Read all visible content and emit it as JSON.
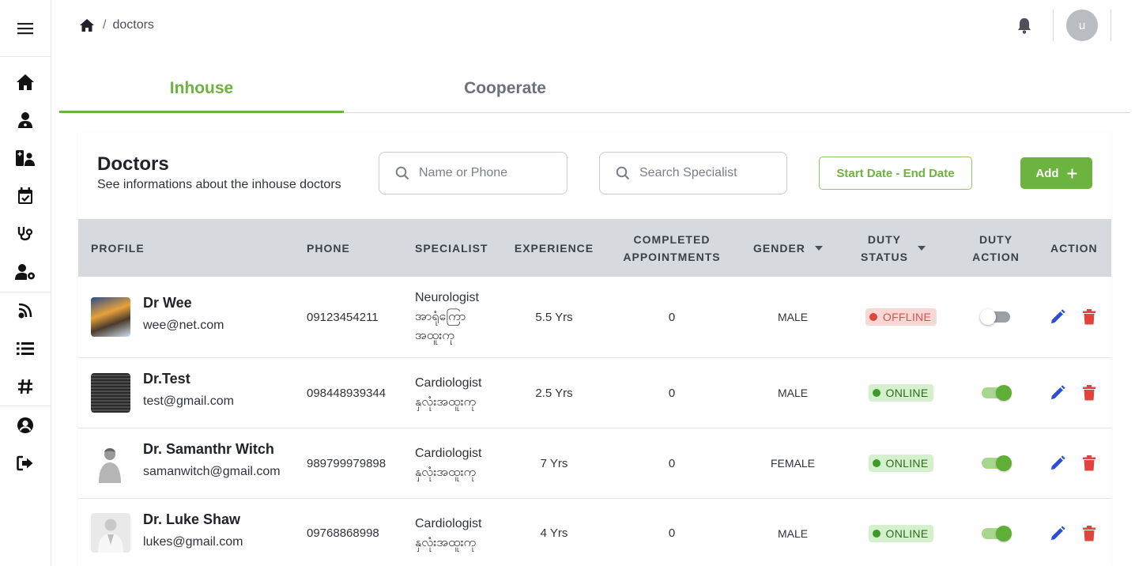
{
  "header": {
    "breadcrumb_separator": "/",
    "breadcrumb_current": "doctors",
    "avatar_initial": "u"
  },
  "tabs": [
    {
      "label": "Inhouse",
      "active": true
    },
    {
      "label": "Cooperate",
      "active": false
    }
  ],
  "card": {
    "title": "Doctors",
    "subtitle": "See informations about the inhouse doctors",
    "search_name_placeholder": "Name or Phone",
    "search_specialist_placeholder": "Search Specialist",
    "date_range_label": "Start Date - End Date",
    "add_label": "Add"
  },
  "table": {
    "columns": {
      "profile": "PROFILE",
      "phone": "PHONE",
      "specialist": "SPECIALIST",
      "experience": "EXPERIENCE",
      "completed_1": "COMPLETED",
      "completed_2": "APPOINTMENTS",
      "gender": "GENDER",
      "duty_status_1": "DUTY",
      "duty_status_2": "STATUS",
      "duty_action_1": "DUTY",
      "duty_action_2": "ACTION",
      "action": "ACTION"
    },
    "rows": [
      {
        "name": "Dr Wee",
        "email": "wee@net.com",
        "phone": "09123454211",
        "specialist_lines": [
          "Neurologist",
          "အာရုံကြော",
          "အထူးကု"
        ],
        "experience": "5.5 Yrs",
        "completed": "0",
        "gender": "MALE",
        "status": "OFFLINE",
        "duty_on": false
      },
      {
        "name": "Dr.Test",
        "email": "test@gmail.com",
        "phone": "098448939344",
        "specialist_lines": [
          "Cardiologist",
          "နှလုံးအထူးကု"
        ],
        "experience": "2.5 Yrs",
        "completed": "0",
        "gender": "MALE",
        "status": "ONLINE",
        "duty_on": true
      },
      {
        "name": "Dr. Samanthr Witch",
        "email": "samanwitch@gmail.com",
        "phone": "989799979898",
        "specialist_lines": [
          "Cardiologist",
          "နှလုံးအထူးကု"
        ],
        "experience": "7 Yrs",
        "completed": "0",
        "gender": "FEMALE",
        "status": "ONLINE",
        "duty_on": true
      },
      {
        "name": "Dr. Luke Shaw",
        "email": "lukes@gmail.com",
        "phone": "09768868998",
        "specialist_lines": [
          "Cardiologist",
          "နှလုံးအထူးကု"
        ],
        "experience": "4 Yrs",
        "completed": "0",
        "gender": "MALE",
        "status": "ONLINE",
        "duty_on": true
      }
    ]
  },
  "colors": {
    "accent": "#6db33f",
    "offline": "#e0443e",
    "online": "#3c9a28",
    "edit": "#2f4bd8",
    "delete": "#e0443e"
  },
  "icons": {
    "sidebar": [
      "home-icon",
      "doctor-icon",
      "patient-card-icon",
      "calendar-check-icon",
      "stethoscope-icon",
      "user-gear-icon",
      "broadcast-icon",
      "list-icon",
      "hashtag-icon",
      "user-circle-icon",
      "logout-icon"
    ]
  }
}
